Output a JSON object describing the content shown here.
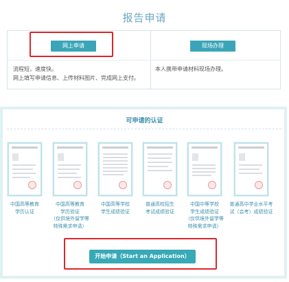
{
  "page_title": "报告申请",
  "online": {
    "button_label": "网上申请",
    "desc_line1": "流程短，速度快。",
    "desc_line2": "网上填写申请信息、上传材料图片、完成网上支付。"
  },
  "onsite": {
    "button_label": "现场办理",
    "desc": "本人携带申请材料现场办理。"
  },
  "cert_section": {
    "title": "可申请的认证",
    "items": [
      {
        "line1": "中国高等教育",
        "line2": "学历认证"
      },
      {
        "line1": "中国高等教育",
        "line2": "学历验证",
        "line3": "（仅供境外留学等",
        "line4": "特殊需求申请）"
      },
      {
        "line1": "中国高等学校",
        "line2": "学生成绩验证"
      },
      {
        "line1": "普通高校招生",
        "line2": "考试成绩验证"
      },
      {
        "line1": "中国中等学校",
        "line2": "学生成绩验证",
        "line3": "（仅供境外留学等",
        "line4": "特殊需求申请）"
      },
      {
        "line1": "普通高中学业水平考",
        "line2": "试（会考）成绩验证"
      }
    ]
  },
  "start_button_label": "开始申请（Start an Application）",
  "colors": {
    "accent": "#3aa5b8",
    "title": "#6aa7c2",
    "highlight": "#d9262b"
  }
}
